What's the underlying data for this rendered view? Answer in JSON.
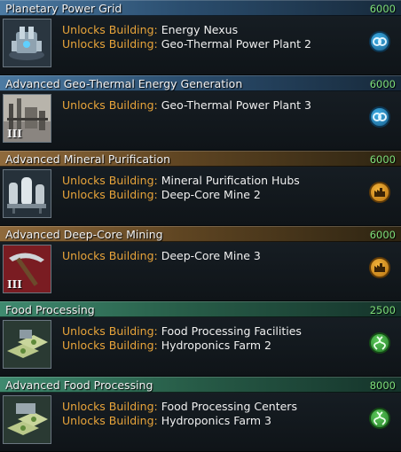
{
  "unlock_prefix": "Unlocks Building:",
  "techs": [
    {
      "title": "Planetary Power Grid",
      "cost": "6000",
      "category": "power",
      "tier": "",
      "unlocks": [
        "Energy Nexus",
        "Geo-Thermal Power Plant 2"
      ]
    },
    {
      "title": "Advanced Geo-Thermal Energy Generation",
      "cost": "6000",
      "category": "power",
      "tier": "III",
      "unlocks": [
        "Geo-Thermal Power Plant 3"
      ]
    },
    {
      "title": "Advanced Mineral Purification",
      "cost": "6000",
      "category": "minerals",
      "tier": "",
      "unlocks": [
        "Mineral Purification Hubs",
        "Deep-Core Mine 2"
      ]
    },
    {
      "title": "Advanced Deep-Core Mining",
      "cost": "6000",
      "category": "minerals",
      "tier": "III",
      "unlocks": [
        "Deep-Core Mine 3"
      ]
    },
    {
      "title": "Food Processing",
      "cost": "2500",
      "category": "food",
      "tier": "",
      "unlocks": [
        "Food Processing Facilities",
        "Hydroponics Farm 2"
      ]
    },
    {
      "title": "Advanced Food Processing",
      "cost": "8000",
      "category": "food",
      "tier": "",
      "unlocks": [
        "Food Processing Centers",
        "Hydroponics Farm 3"
      ]
    }
  ],
  "colors": {
    "power_header": "#4c7aa2",
    "mine_header": "#8f6a3c",
    "food_header": "#3f8a6f",
    "cost_text": "#7fe07a",
    "unlock_prefix": "#e8a43a"
  }
}
